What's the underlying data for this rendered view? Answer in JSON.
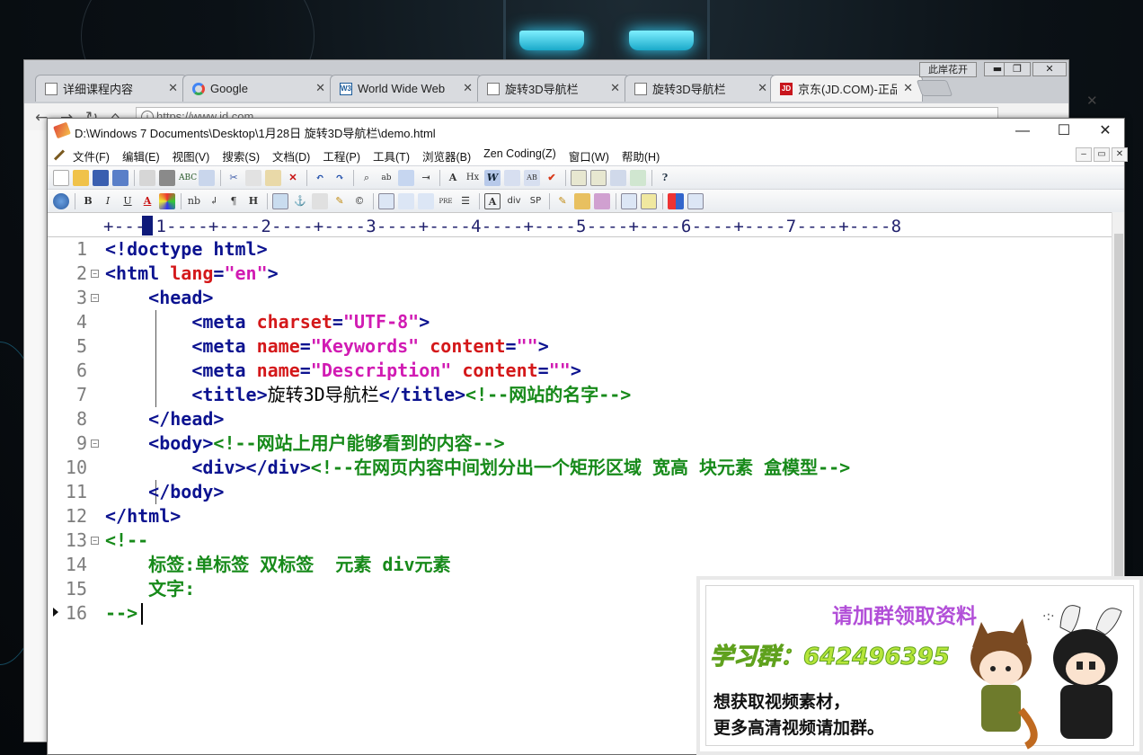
{
  "browser": {
    "tabs": [
      {
        "title": "详细课程内容",
        "icon": "page-icon",
        "close": "✕"
      },
      {
        "title": "Google",
        "icon": "google-icon",
        "close": "✕"
      },
      {
        "title": "World Wide Web",
        "icon": "w3c-icon",
        "close": "✕"
      },
      {
        "title": "旋转3D导航栏",
        "icon": "page-icon",
        "close": "✕"
      },
      {
        "title": "旋转3D导航栏",
        "icon": "page-icon",
        "close": "✕"
      },
      {
        "title": "京东(JD.COM)-正品",
        "icon": "jd-icon",
        "close": "✕"
      }
    ],
    "user_chip": "此岸花开",
    "url": "https://www.jd.com",
    "window_controls": {
      "minimize": "▬",
      "restore": "❐",
      "close": "✕"
    },
    "nav": {
      "back": "←",
      "forward": "→",
      "reload": "↻",
      "home": "⌂"
    },
    "side_close": "✕"
  },
  "editor": {
    "title": "D:\\Windows 7 Documents\\Desktop\\1月28日 旋转3D导航栏\\demo.html",
    "window_controls": {
      "minimize": "—",
      "maximize": "☐",
      "close": "✕"
    },
    "menu": [
      "文件(F)",
      "编辑(E)",
      "视图(V)",
      "搜索(S)",
      "文档(D)",
      "工程(P)",
      "工具(T)",
      "浏览器(B)",
      "Zen Coding(Z)",
      "窗口(W)",
      "帮助(H)"
    ],
    "mdi_controls": [
      "–",
      "▭",
      "✕"
    ],
    "toolbar2_labels": {
      "bold": "B",
      "italic": "I",
      "underline": "U",
      "color": "A",
      "nb": "nb",
      "br": "↲",
      "para": "¶",
      "hr": "H",
      "pre": "PRE",
      "div": "div",
      "sp": "SP"
    },
    "ruler": "+----1----+----2----+----3----+----4----+----5----+----6----+----7----+----8",
    "lines": [
      {
        "n": "1",
        "fold": false,
        "tokens": [
          [
            "tag",
            "<!doctype html>"
          ]
        ]
      },
      {
        "n": "2",
        "fold": true,
        "tokens": [
          [
            "tag",
            "<html "
          ],
          [
            "attr",
            "lang"
          ],
          [
            "tag",
            "="
          ],
          [
            "val",
            "\"en\""
          ],
          [
            "tag",
            ">"
          ]
        ]
      },
      {
        "n": "3",
        "fold": true,
        "tokens": [
          [
            "txt",
            "    "
          ],
          [
            "tag",
            "<head>"
          ]
        ]
      },
      {
        "n": "4",
        "fold": false,
        "tokens": [
          [
            "txt",
            "        "
          ],
          [
            "tag",
            "<meta "
          ],
          [
            "attr",
            "charset"
          ],
          [
            "tag",
            "="
          ],
          [
            "val",
            "\"UTF-8\""
          ],
          [
            "tag",
            ">"
          ]
        ]
      },
      {
        "n": "5",
        "fold": false,
        "tokens": [
          [
            "txt",
            "        "
          ],
          [
            "tag",
            "<meta "
          ],
          [
            "attr",
            "name"
          ],
          [
            "tag",
            "="
          ],
          [
            "val",
            "\"Keywords\" "
          ],
          [
            "attr",
            "content"
          ],
          [
            "tag",
            "="
          ],
          [
            "val",
            "\"\""
          ],
          [
            "tag",
            ">"
          ]
        ]
      },
      {
        "n": "6",
        "fold": false,
        "tokens": [
          [
            "txt",
            "        "
          ],
          [
            "tag",
            "<meta "
          ],
          [
            "attr",
            "name"
          ],
          [
            "tag",
            "="
          ],
          [
            "val",
            "\"Description\" "
          ],
          [
            "attr",
            "content"
          ],
          [
            "tag",
            "="
          ],
          [
            "val",
            "\"\""
          ],
          [
            "tag",
            ">"
          ]
        ]
      },
      {
        "n": "7",
        "fold": false,
        "tokens": [
          [
            "txt",
            "        "
          ],
          [
            "tag",
            "<title>"
          ],
          [
            "txt",
            "旋转3D导航栏"
          ],
          [
            "tag",
            "</title>"
          ],
          [
            "cmt",
            "<!--网站的名字-->"
          ]
        ]
      },
      {
        "n": "8",
        "fold": false,
        "tokens": [
          [
            "txt",
            "    "
          ],
          [
            "tag",
            "</head>"
          ]
        ]
      },
      {
        "n": "9",
        "fold": true,
        "tokens": [
          [
            "txt",
            "    "
          ],
          [
            "tag",
            "<body>"
          ],
          [
            "cmt",
            "<!--网站上用户能够看到的内容-->"
          ]
        ]
      },
      {
        "n": "10",
        "fold": false,
        "tokens": [
          [
            "txt",
            "        "
          ],
          [
            "tag",
            "<div></div>"
          ],
          [
            "cmt",
            "<!--在网页内容中间划分出一个矩形区域 宽高 块元素 盒模型-->"
          ]
        ]
      },
      {
        "n": "11",
        "fold": false,
        "tokens": [
          [
            "txt",
            "    "
          ],
          [
            "tag",
            "</body>"
          ]
        ]
      },
      {
        "n": "12",
        "fold": false,
        "tokens": [
          [
            "tag",
            "</html>"
          ]
        ]
      },
      {
        "n": "13",
        "fold": true,
        "tokens": [
          [
            "cmt",
            "<!--"
          ]
        ]
      },
      {
        "n": "14",
        "fold": false,
        "tokens": [
          [
            "txt",
            "    "
          ],
          [
            "cmt",
            "标签:单标签 双标签  元素 div元素"
          ]
        ]
      },
      {
        "n": "15",
        "fold": false,
        "tokens": [
          [
            "txt",
            "    "
          ],
          [
            "cmt",
            "文字:"
          ]
        ]
      },
      {
        "n": "16",
        "fold": false,
        "tokens": [
          [
            "cmt",
            "-->"
          ]
        ]
      }
    ]
  },
  "promo": {
    "title": "请加群领取资料",
    "group": "学习群：642496395",
    "line1": "想获取视频素材，",
    "line2": "更多高清视频请加群。"
  },
  "colors": {
    "tag": "#0c1390",
    "attr": "#d4181a",
    "value": "#d11bb3",
    "comment": "#178a1a",
    "promo_title": "#b24fd8",
    "promo_group": "#b6e63a"
  }
}
